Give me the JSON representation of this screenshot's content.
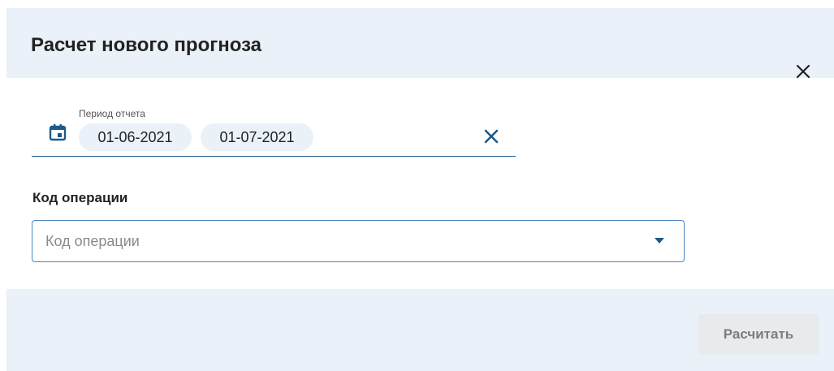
{
  "dialog": {
    "title": "Расчет нового прогноза",
    "close_icon": "close-icon"
  },
  "period": {
    "label": "Период отчета",
    "start": "01-06-2021",
    "end": "01-07-2021",
    "icon": "calendar-icon",
    "clear_icon": "clear-icon"
  },
  "operation": {
    "label": "Код операции",
    "placeholder": "Код операции",
    "value": ""
  },
  "footer": {
    "submit_label": "Расчитать",
    "submit_disabled": true
  },
  "colors": {
    "header_bg": "#eaf1f8",
    "accent": "#1c5a8c",
    "input_border": "#4a86c0",
    "button_disabled_bg": "#e7ebee"
  }
}
